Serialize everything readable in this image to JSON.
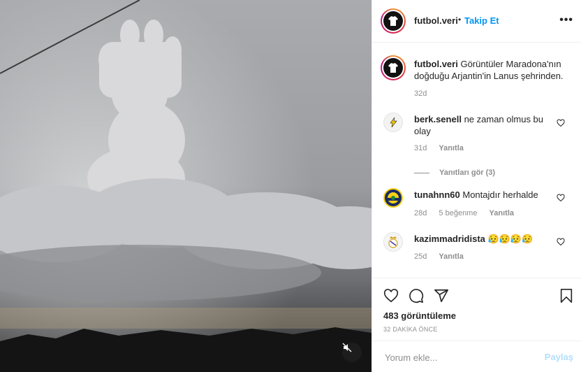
{
  "post": {
    "media": {
      "description_icon": "mute-icon"
    },
    "header": {
      "username": "futbol.veri",
      "separator": "•",
      "follow_label": "Takip Et",
      "more_label": "•••"
    },
    "caption": {
      "username": "futbol.veri",
      "text": "Görüntüler Maradona'nın doğduğu Arjantin'in Lanus şehrinden.",
      "time": "32d"
    },
    "comments": [
      {
        "username": "berk.senell",
        "text": "ne zaman olmus bu olay",
        "time": "31d",
        "likes": "",
        "reply_label": "Yanıtla",
        "avatar_icon": "lightning-avatar"
      },
      {
        "username": "tunahnn60",
        "text": "Montajdır herhalde",
        "time": "28d",
        "likes": "5 beğenme",
        "reply_label": "Yanıtla",
        "avatar_icon": "fenerbahce-badge-avatar"
      },
      {
        "username": "kazimmadridista",
        "text": "😥😥😥😥",
        "time": "25d",
        "likes": "",
        "reply_label": "Yanıtla",
        "avatar_icon": "real-madrid-crest-avatar"
      }
    ],
    "view_replies_label": "Yanıtları gör (3)",
    "views": "483 görüntüleme",
    "posted_ago": "32 DAKİKA ÖNCE",
    "add_comment": {
      "placeholder": "Yorum ekle...",
      "post_label": "Paylaş"
    },
    "colors": {
      "link": "#0095f6",
      "muted": "#8e8e8e",
      "disabled_post": "#b2dffc"
    }
  }
}
